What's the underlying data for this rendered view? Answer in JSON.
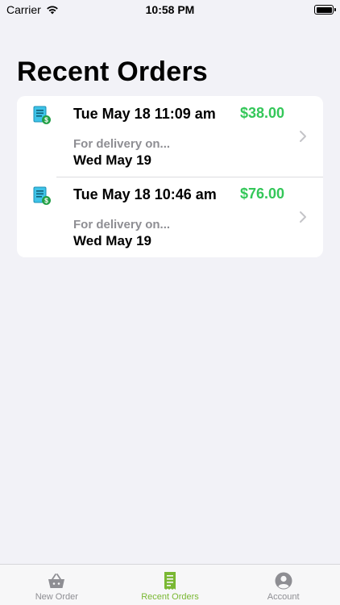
{
  "status_bar": {
    "carrier": "Carrier",
    "time": "10:58 PM"
  },
  "page": {
    "title": "Recent Orders"
  },
  "orders": [
    {
      "date": "Tue May 18 11:09 am",
      "total": "$38.00",
      "delivery_label": "For delivery on...",
      "delivery_date": "Wed May 19"
    },
    {
      "date": "Tue May 18 10:46 am",
      "total": "$76.00",
      "delivery_label": "For delivery on...",
      "delivery_date": "Wed May 19"
    }
  ],
  "tabs": [
    {
      "label": "New Order",
      "icon": "basket-icon",
      "active": false
    },
    {
      "label": "Recent Orders",
      "icon": "receipt-icon",
      "active": true
    },
    {
      "label": "Account",
      "icon": "person-icon",
      "active": false
    }
  ],
  "colors": {
    "background": "#f2f2f7",
    "price_green": "#34c759",
    "tab_active": "#7ab833",
    "tab_inactive": "#8e8e93",
    "secondary_text": "#8e8e93"
  }
}
